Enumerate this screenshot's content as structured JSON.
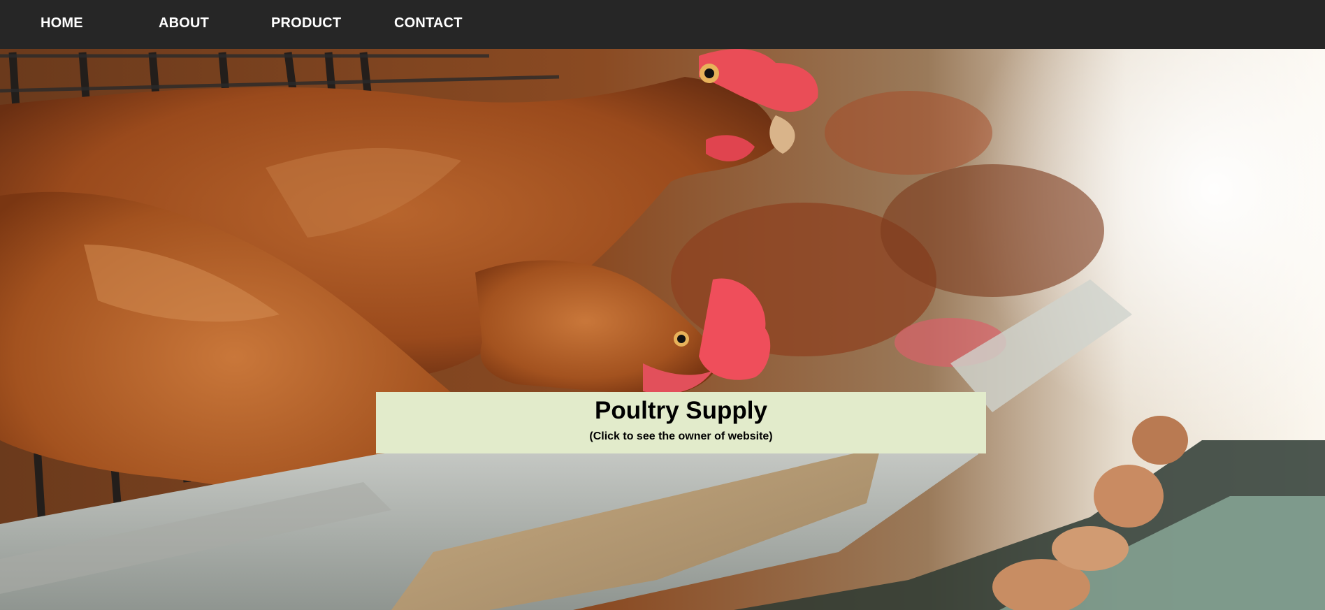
{
  "nav": {
    "items": [
      {
        "label": "HOME"
      },
      {
        "label": "ABOUT"
      },
      {
        "label": "PRODUCT"
      },
      {
        "label": "CONTACT"
      }
    ]
  },
  "hero": {
    "image_subject": "hens-in-cage-feeding-photo",
    "title": "Poultry Supply",
    "subtitle": "(Click to see the owner of website)"
  },
  "colors": {
    "navbar_bg": "#262626",
    "nav_text": "#ffffff",
    "title_box_bg": "#e2ebcb",
    "title_text": "#000000"
  }
}
